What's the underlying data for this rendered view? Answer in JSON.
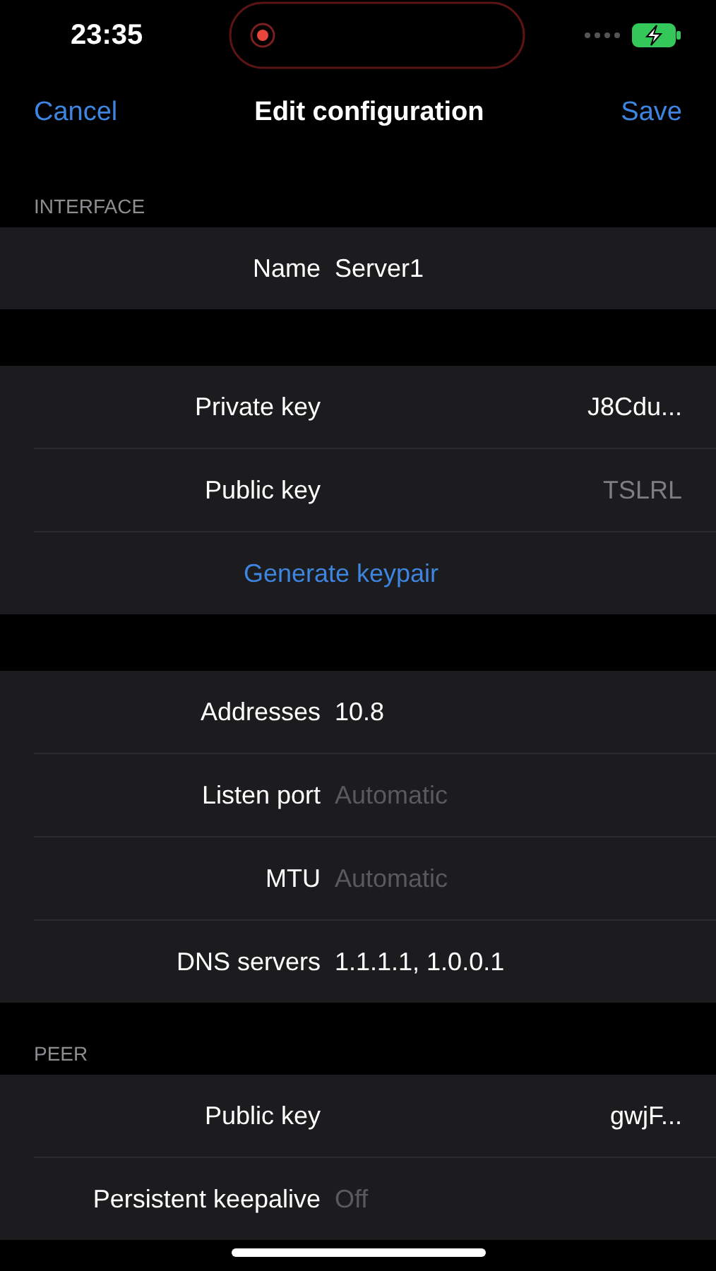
{
  "status_bar": {
    "time": "23:35"
  },
  "nav": {
    "cancel": "Cancel",
    "title": "Edit configuration",
    "save": "Save"
  },
  "sections": [
    {
      "header": "INTERFACE",
      "rows": [
        {
          "kind": "field",
          "label": "Name",
          "value": "Server1"
        }
      ]
    },
    {
      "rows": [
        {
          "kind": "readonly",
          "label": "Private key",
          "value": "J8Cdu...",
          "dimmed": false
        },
        {
          "kind": "readonly",
          "label": "Public key",
          "value": "TSLRL",
          "dimmed": true
        },
        {
          "kind": "button",
          "label": "Generate keypair"
        }
      ]
    },
    {
      "rows": [
        {
          "kind": "field",
          "label": "Addresses",
          "value": "10.8"
        },
        {
          "kind": "field",
          "label": "Listen port",
          "placeholder": "Automatic"
        },
        {
          "kind": "field",
          "label": "MTU",
          "placeholder": "Automatic"
        },
        {
          "kind": "field",
          "label": "DNS servers",
          "value": "1.1.1.1, 1.0.0.1"
        }
      ]
    },
    {
      "header": "PEER",
      "rows": [
        {
          "kind": "readonly",
          "label": "Public key",
          "value": "gwjF...",
          "dimmed": false
        },
        {
          "kind": "field",
          "label": "Persistent keepalive",
          "placeholder": "Off"
        }
      ]
    }
  ]
}
